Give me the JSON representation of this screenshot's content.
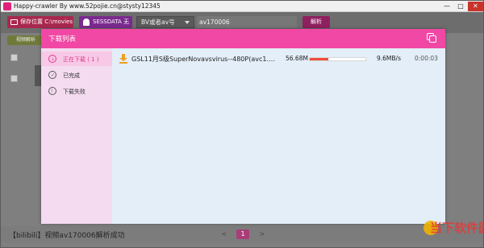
{
  "window": {
    "title": "Happy-crawler By www.52pojie.cn@stysty12345",
    "minimize": "—",
    "maximize": "□",
    "close": "✕"
  },
  "toolbar": {
    "save_location": "保存位置 C:\\movies",
    "sessdata": "SESSDATA 无",
    "select_value": "BV或者av号",
    "input_value": "av170006",
    "parse_button": "解析"
  },
  "background": {
    "side_button": "视频解析",
    "status_text": "【bilibili】视频av170006解析成功",
    "pager": {
      "prev": "<",
      "page": "1",
      "next": ">"
    }
  },
  "modal": {
    "title": "下载列表",
    "nav": [
      {
        "label": "正在下载 ( 1 )",
        "icon": "downloading-icon"
      },
      {
        "label": "已完成",
        "icon": "completed-icon"
      },
      {
        "label": "下载失败",
        "icon": "failed-icon"
      }
    ],
    "downloads": [
      {
        "name": "GSL11月S级SuperNovavsvirus--480P(avc1.640...",
        "size": "56.68M",
        "progress": 0.33,
        "speed": "9.6MB/s",
        "time": "0:00:03"
      }
    ]
  },
  "watermark": {
    "text": "当下软件园"
  },
  "colors": {
    "accent_pink": "#f048a4",
    "progress_fill": "#f04d3a",
    "download_icon": "#f0a020",
    "sidebar_bg": "#f4dbf0",
    "content_bg": "#e3eef8"
  }
}
